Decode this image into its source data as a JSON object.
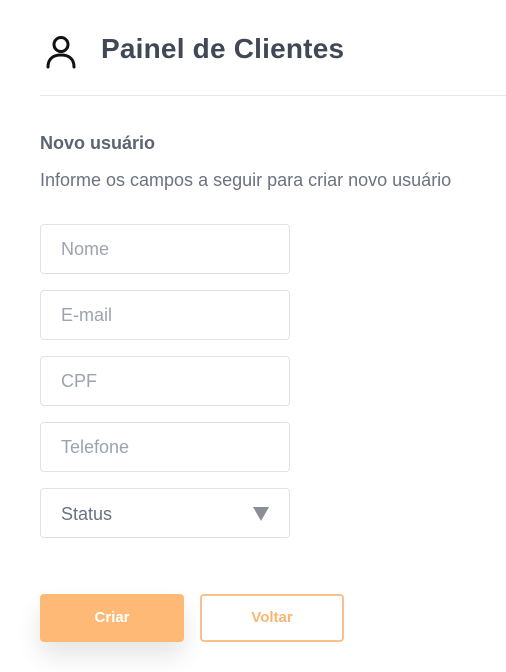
{
  "header": {
    "icon": "user-icon",
    "title": "Painel de Clientes"
  },
  "form": {
    "title": "Novo usuário",
    "subtitle": "Informe os campos a seguir para criar novo usuário",
    "fields": {
      "nome": {
        "placeholder": "Nome",
        "value": ""
      },
      "email": {
        "placeholder": "E-mail",
        "value": ""
      },
      "cpf": {
        "placeholder": "CPF",
        "value": ""
      },
      "telefone": {
        "placeholder": "Telefone",
        "value": ""
      }
    },
    "status": {
      "selected": "Status",
      "icon": "triangle-down-icon"
    },
    "buttons": {
      "create": "Criar",
      "back": "Voltar"
    }
  },
  "colors": {
    "primary": "#fdb975",
    "secondary_border": "#fbc08a",
    "text_dark": "#3f4854"
  }
}
